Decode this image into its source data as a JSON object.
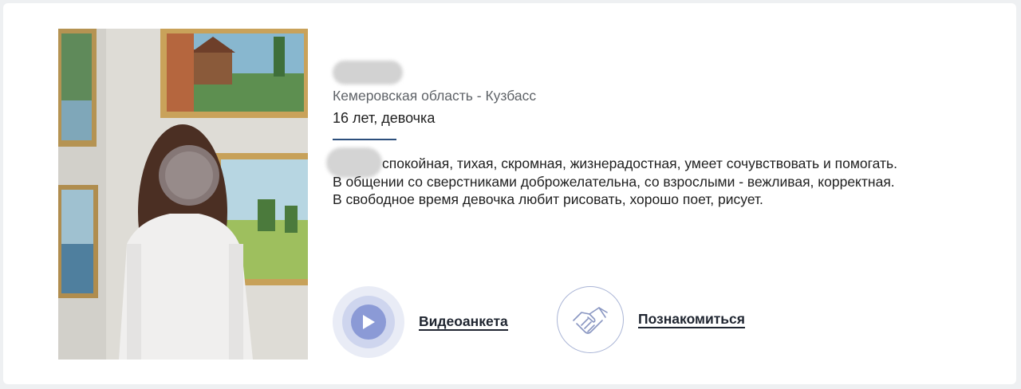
{
  "profile": {
    "region": "Кемеровская область - Кузбасс",
    "age_gender": "16 лет, девочка",
    "description": "спокойная, тихая, скромная, жизнерадостная, умеет сочувствовать и помогать. В общении со сверстниками доброжелательна, со взрослыми - вежливая, корректная. В свободное время девочка любит рисовать, хорошо поет, рисует."
  },
  "actions": {
    "video_label": "Видеоанкета",
    "meet_label": "Познакомиться"
  },
  "icons": {
    "video": "play-icon",
    "meet": "handshake-icon"
  },
  "colors": {
    "divider": "#2d4f7c",
    "play_core": "#8b9ad6",
    "meet_border": "#aab5d6"
  }
}
